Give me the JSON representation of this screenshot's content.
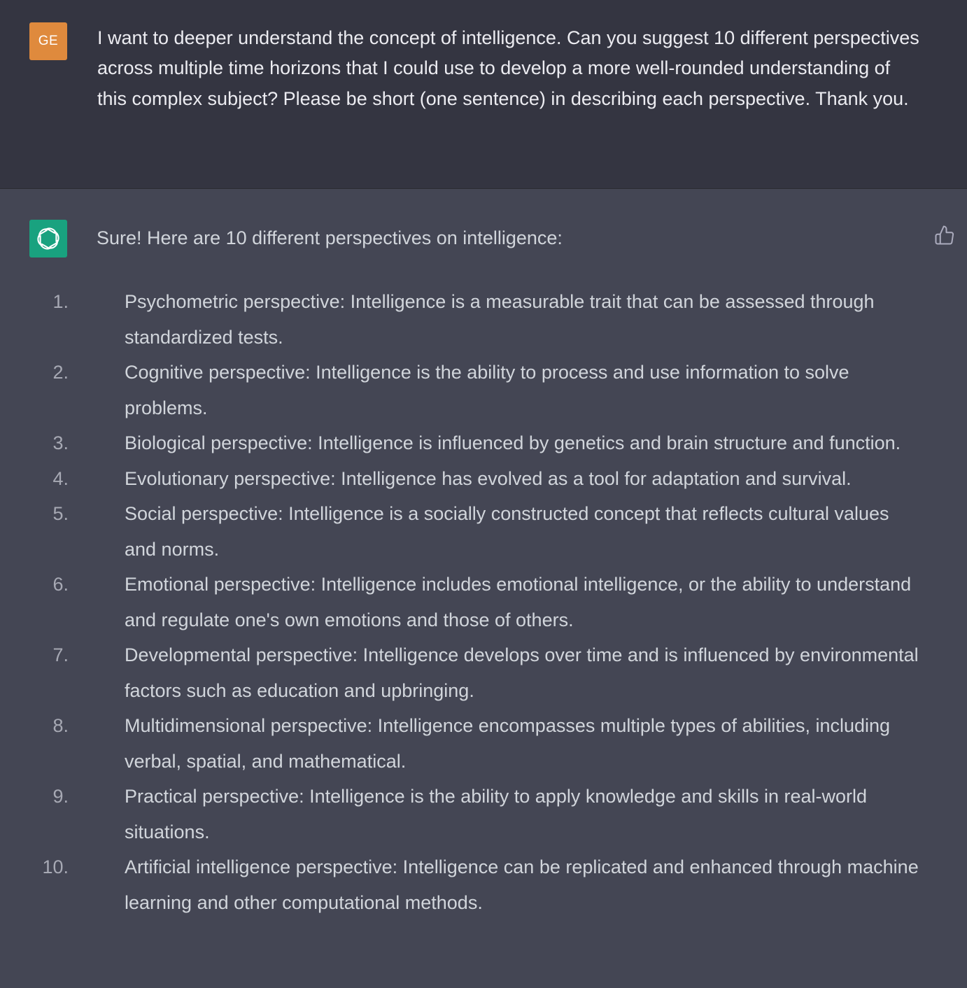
{
  "user": {
    "avatar_initials": "GE",
    "message": "I want to deeper understand the concept of intelligence. Can you suggest 10 different perspectives across multiple time horizons that I could use to develop a more well-rounded understanding of this complex subject? Please be short (one sentence) in describing each perspective. Thank you."
  },
  "assistant": {
    "avatar_icon": "openai-logo-icon",
    "intro": "Sure! Here are 10 different perspectives on intelligence:",
    "feedback_icon": "thumbs-up-icon",
    "items": [
      {
        "num": "1.",
        "text": "Psychometric perspective: Intelligence is a measurable trait that can be assessed through standardized tests."
      },
      {
        "num": "2.",
        "text": "Cognitive perspective: Intelligence is the ability to process and use information to solve problems."
      },
      {
        "num": "3.",
        "text": "Biological perspective: Intelligence is influenced by genetics and brain structure and function."
      },
      {
        "num": "4.",
        "text": "Evolutionary perspective: Intelligence has evolved as a tool for adaptation and survival."
      },
      {
        "num": "5.",
        "text": "Social perspective: Intelligence is a socially constructed concept that reflects cultural values and norms."
      },
      {
        "num": "6.",
        "text": "Emotional perspective: Intelligence includes emotional intelligence, or the ability to understand and regulate one's own emotions and those of others."
      },
      {
        "num": "7.",
        "text": "Developmental perspective: Intelligence develops over time and is influenced by environmental factors such as education and upbringing."
      },
      {
        "num": "8.",
        "text": "Multidimensional perspective: Intelligence encompasses multiple types of abilities, including verbal, spatial, and mathematical."
      },
      {
        "num": "9.",
        "text": "Practical perspective: Intelligence is the ability to apply knowledge and skills in real-world situations."
      },
      {
        "num": "10.",
        "text": "Artificial intelligence perspective: Intelligence can be replicated and enhanced through machine learning and other computational methods."
      }
    ]
  },
  "colors": {
    "user_bg": "#343541",
    "assistant_bg": "#444654",
    "user_avatar": "#df8a3d",
    "bot_avatar": "#19a27f"
  }
}
